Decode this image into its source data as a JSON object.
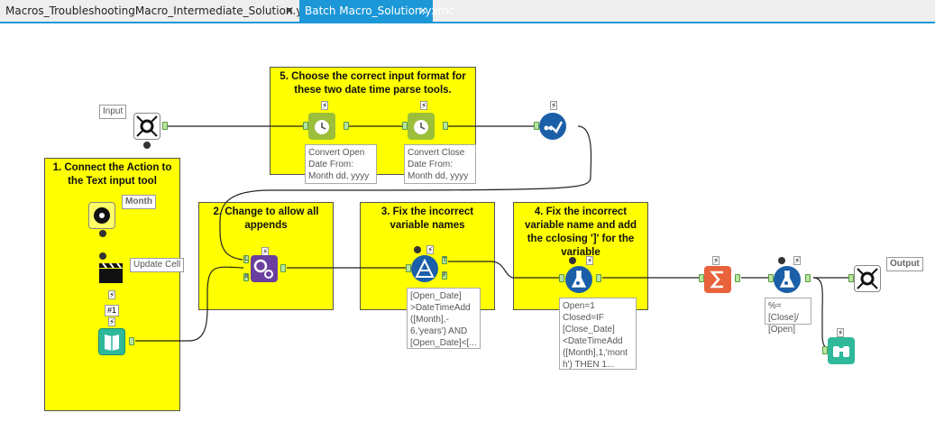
{
  "tabs": [
    {
      "label": "Macros_TroubleshootingMacro_Intermediate_Solution.yxmd",
      "close": "✕"
    },
    {
      "label": "Batch Macro_Solution.yxmc",
      "close": "✕"
    }
  ],
  "comments": {
    "c1": "1. Connect the Action to the Text input tool",
    "c2": "2. Change to allow all appends",
    "c3": "3. Fix the incorrect variable names",
    "c4": "4. Fix the incorrect variable name and add the cclosing ']' for the variable",
    "c5": "5. Choose the correct input format for these two date time parse tools."
  },
  "labels": {
    "input": "Input",
    "month": "Month",
    "update_cell": "Update Cell",
    "output": "Output",
    "num1": "#1"
  },
  "annotations": {
    "dt1": "Convert Open Date From: Month dd, yyyy",
    "dt2": "Convert Close Date From: Month dd, yyyy",
    "filter": "[Open_Date] >DateTimeAdd ([Month],- 6,'years') AND [Open_Date]<[...",
    "formula1": "Open=1 Closed=IF [Close_Date] <DateTimeAdd ([Month],1,'mont h') THEN 1...",
    "formula2": "%=[Close]/ [Open]"
  },
  "anchors": {
    "t": "T",
    "f": "F",
    "l": "L",
    "r": "R"
  },
  "colors": {
    "accent": "#1c97d7",
    "comment": "#ffff00",
    "wire": "#222222"
  }
}
